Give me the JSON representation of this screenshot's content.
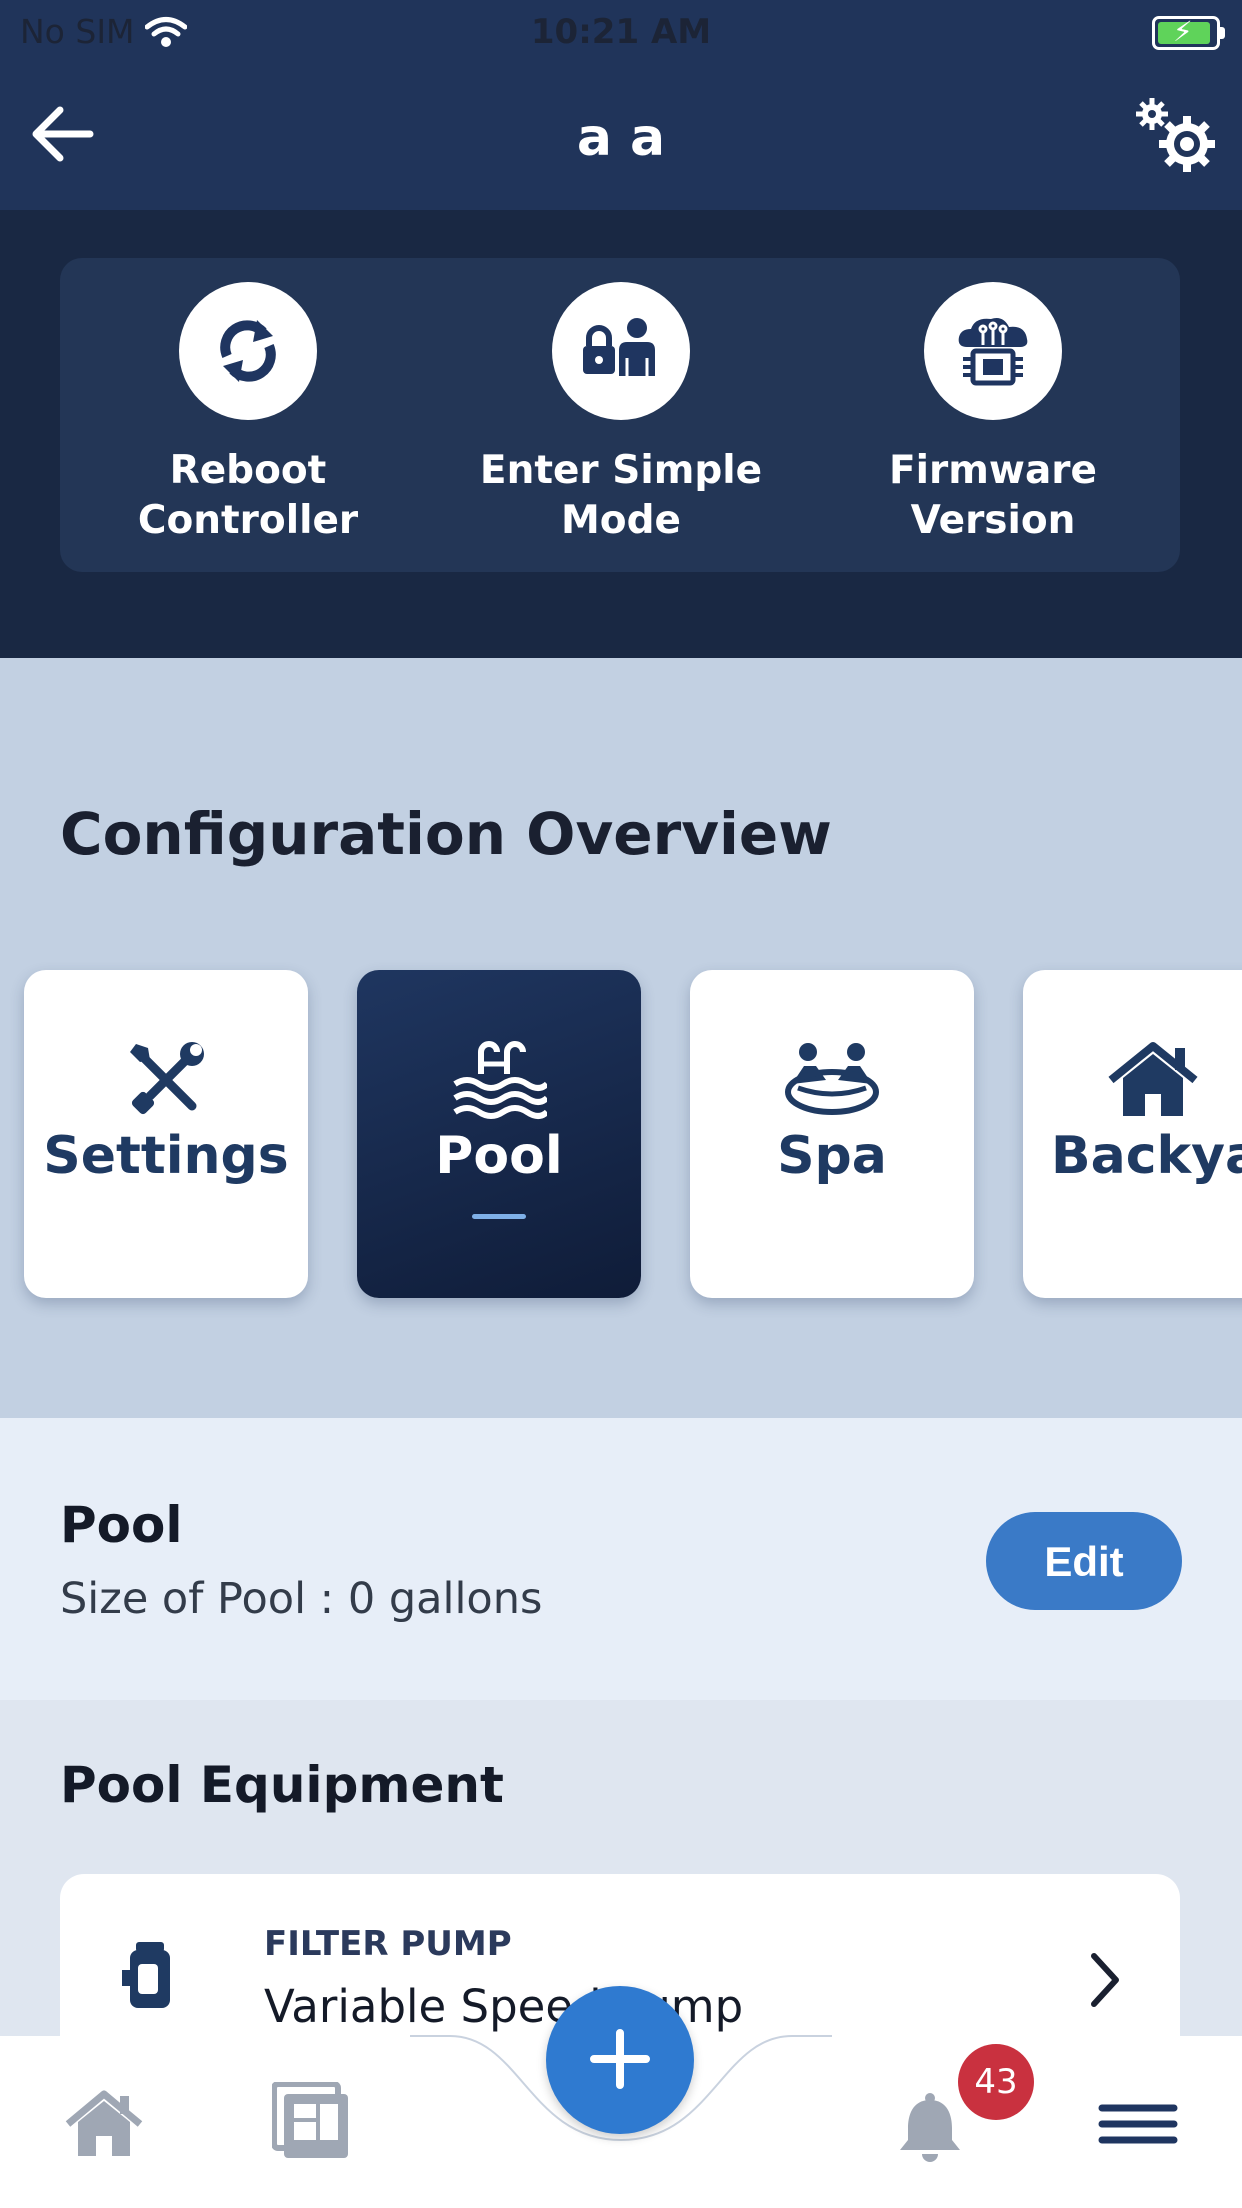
{
  "status": {
    "carrier": "No SIM",
    "time": "10:21 AM"
  },
  "nav": {
    "title": "a a"
  },
  "quick_actions": [
    {
      "label": "Reboot\nController",
      "icon": "sync-icon"
    },
    {
      "label": "Enter Simple\nMode",
      "icon": "lock-user-icon"
    },
    {
      "label": "Firmware\nVersion",
      "icon": "cloud-chip-icon"
    }
  ],
  "config": {
    "title": "Configuration Overview",
    "categories": [
      {
        "label": "Settings",
        "icon": "tools-icon",
        "active": false
      },
      {
        "label": "Pool",
        "icon": "pool-icon",
        "active": true
      },
      {
        "label": "Spa",
        "icon": "spa-icon",
        "active": false
      },
      {
        "label": "Backyard",
        "icon": "house-icon",
        "active": false
      }
    ]
  },
  "pool": {
    "title": "Pool",
    "size": "Size of Pool : 0 gallons",
    "edit_label": "Edit"
  },
  "equipment": {
    "title": "Pool Equipment",
    "items": [
      {
        "type": "FILTER PUMP",
        "name": "Variable Speed Pump",
        "icon": "filter-pump-icon"
      }
    ]
  },
  "tabbar": {
    "notification_count": "43"
  },
  "colors": {
    "navy": "#20345a",
    "accent": "#3a7ac7",
    "badge": "#c9313f"
  }
}
